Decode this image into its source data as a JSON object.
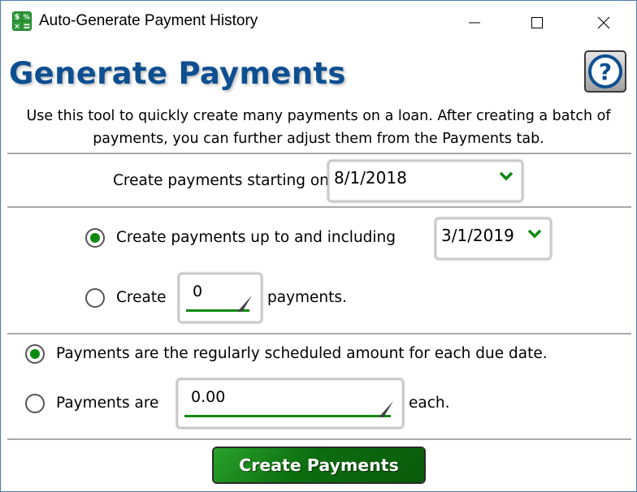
{
  "window": {
    "title": "Auto-Generate Payment History",
    "app_icon": "calculator-icon",
    "controls": [
      "minimize-icon",
      "maximize-icon",
      "close-icon"
    ]
  },
  "header": {
    "title": "Generate Payments",
    "help_icon": "help-icon"
  },
  "description": {
    "line1": "Use this tool to quickly create many payments on a loan. After creating a batch of",
    "line2": "payments, you can further adjust them from the Payments tab."
  },
  "start": {
    "label": "Create payments starting on",
    "value": "8/1/2018"
  },
  "range": {
    "option_until": {
      "label": "Create payments up to and including",
      "value": "3/1/2019",
      "selected": true
    },
    "option_count": {
      "prefix": "Create",
      "value": "0",
      "suffix": "payments.",
      "selected": false
    }
  },
  "amount": {
    "option_scheduled": {
      "label": "Payments are the regularly scheduled amount for each due date.",
      "selected": true
    },
    "option_fixed": {
      "prefix": "Payments are",
      "value": "0.00",
      "suffix": "each.",
      "selected": false
    }
  },
  "actions": {
    "create_label": "Create Payments"
  },
  "colors": {
    "accent_green": "#0d8a0d",
    "heading_blue": "#0d4f91",
    "window_border": "#4a7bab"
  }
}
